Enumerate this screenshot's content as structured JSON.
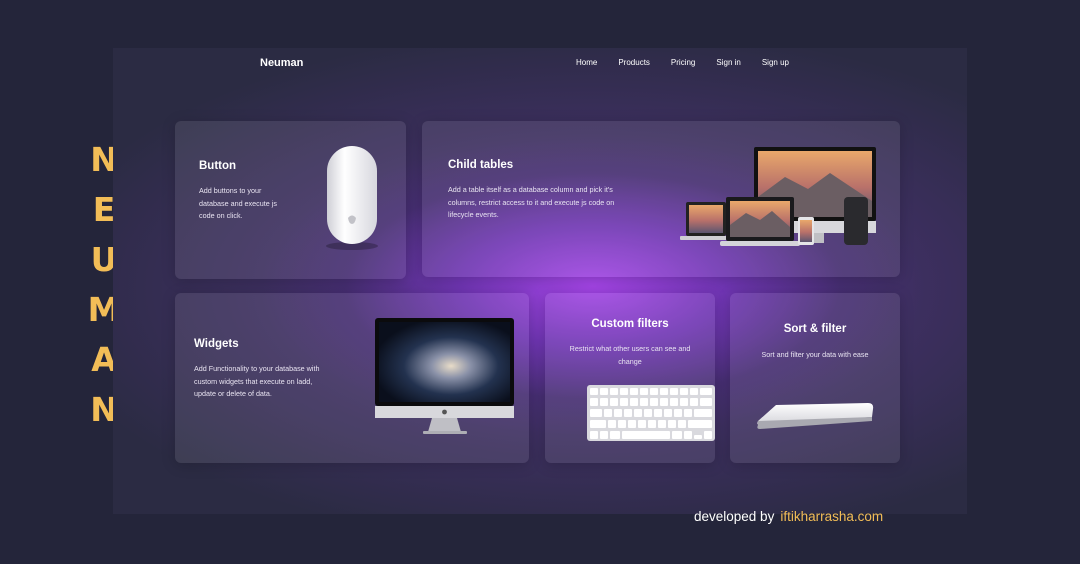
{
  "brand_vertical": [
    "N",
    "E",
    "U",
    "M",
    "A",
    "N"
  ],
  "nav": {
    "logo": "Neuman",
    "links": [
      "Home",
      "Products",
      "Pricing",
      "Sign in",
      "Sign up"
    ]
  },
  "cards": {
    "button": {
      "title": "Button",
      "desc": "Add buttons to your database and execute js code on click."
    },
    "child_tables": {
      "title": "Child tables",
      "desc": "Add a table itself as a database column and pick it's columns, restrict access to it and execute js code on lifecycle events."
    },
    "widgets": {
      "title": "Widgets",
      "desc": "Add Functionality to your database with custom widgets that execute on ladd, update or delete of data."
    },
    "custom_filters": {
      "title": "Custom filters",
      "desc": "Restrict what other users can see and change"
    },
    "sort_filter": {
      "title": "Sort & filter",
      "desc": "Sort and filter your data with ease"
    }
  },
  "footer": {
    "prefix": "developed by",
    "site": "iftikharrasha.com"
  },
  "colors": {
    "accent": "#f2bd57",
    "background": "#24253a",
    "glow": "#a846eb"
  }
}
